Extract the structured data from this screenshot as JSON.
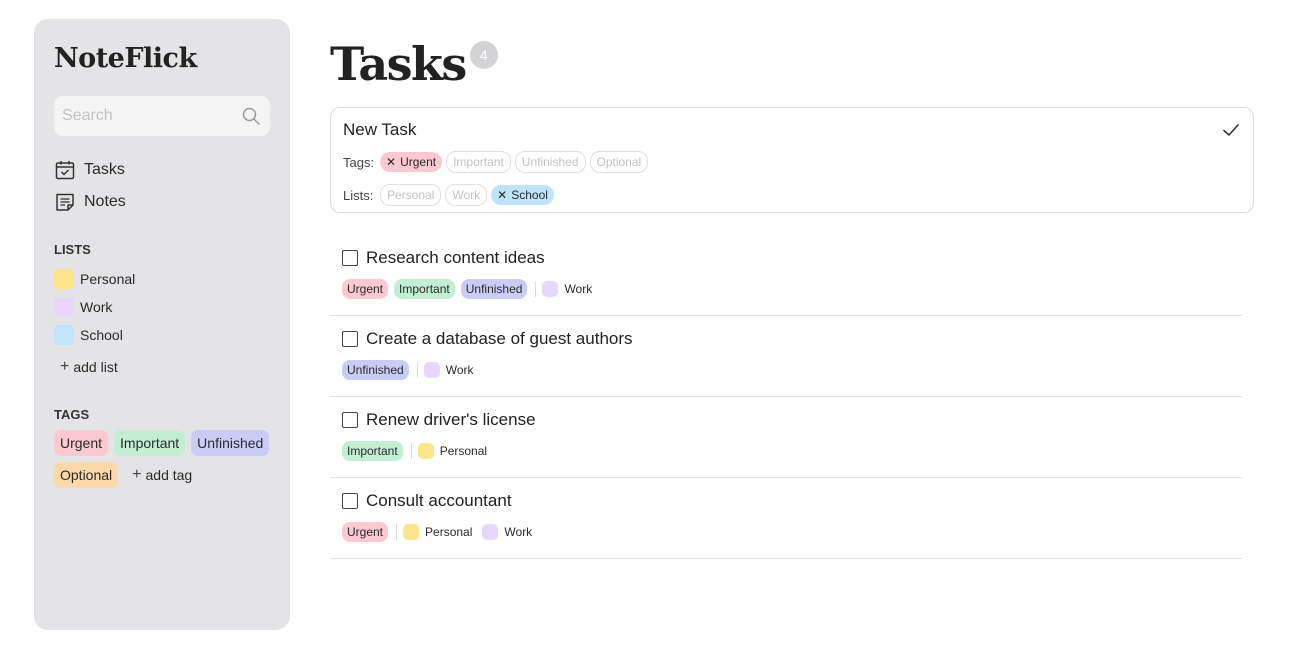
{
  "app": {
    "brand": "NoteFlick"
  },
  "colors": {
    "urgent": "#fbc9cf",
    "important": "#c2efd2",
    "unfinished": "#c9cdf6",
    "optional": "#fdd8a9",
    "personal": "#fde58b",
    "work": "#e9d7fb",
    "school": "#bfe3fb"
  },
  "sidebar": {
    "search_placeholder": "Search",
    "nav": [
      {
        "label": "Tasks",
        "icon": "calendar-check-icon"
      },
      {
        "label": "Notes",
        "icon": "note-icon"
      }
    ],
    "lists_title": "LISTS",
    "lists": [
      {
        "label": "Personal",
        "color": "#fde58b"
      },
      {
        "label": "Work",
        "color": "#e9d7fb"
      },
      {
        "label": "School",
        "color": "#bfe3fb"
      }
    ],
    "add_list": "add list",
    "tags_title": "TAGS",
    "tags": [
      {
        "label": "Urgent",
        "color": "#fbc9cf"
      },
      {
        "label": "Important",
        "color": "#c2efd2"
      },
      {
        "label": "Unfinished",
        "color": "#c9cdf6"
      },
      {
        "label": "Optional",
        "color": "#fdd8a9"
      }
    ],
    "add_tag": "add tag"
  },
  "main": {
    "title": "Tasks",
    "count": "4",
    "new_task": {
      "placeholder": "New Task",
      "tags_label": "Tags:",
      "lists_label": "Lists:",
      "tag_chips": [
        {
          "label": "Urgent",
          "selected": true
        },
        {
          "label": "Important",
          "selected": false
        },
        {
          "label": "Unfinished",
          "selected": false
        },
        {
          "label": "Optional",
          "selected": false
        }
      ],
      "list_chips": [
        {
          "label": "Personal",
          "selected": false
        },
        {
          "label": "Work",
          "selected": false
        },
        {
          "label": "School",
          "selected": true
        }
      ]
    },
    "tasks": [
      {
        "title": "Research content ideas",
        "tags": [
          "Urgent",
          "Important",
          "Unfinished"
        ],
        "lists": [
          "Work"
        ]
      },
      {
        "title": "Create a database of guest authors",
        "tags": [
          "Unfinished"
        ],
        "lists": [
          "Work"
        ]
      },
      {
        "title": "Renew driver's license",
        "tags": [
          "Important"
        ],
        "lists": [
          "Personal"
        ]
      },
      {
        "title": "Consult accountant",
        "tags": [
          "Urgent"
        ],
        "lists": [
          "Personal",
          "Work"
        ]
      }
    ]
  }
}
